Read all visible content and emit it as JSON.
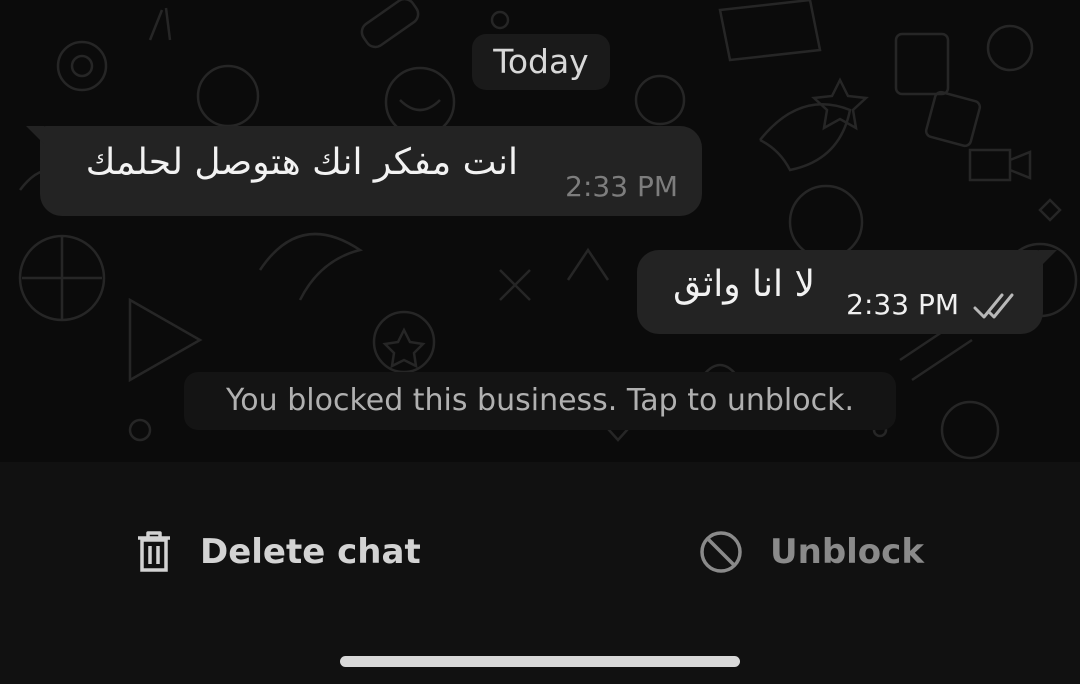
{
  "chat": {
    "date_label": "Today",
    "messages": [
      {
        "direction": "incoming",
        "text": "انت مفكر انك هتوصل لحلمك",
        "time": "2:33 PM"
      },
      {
        "direction": "outgoing",
        "text": "لا انا واثق",
        "time": "2:33 PM",
        "status": "read"
      }
    ],
    "system_notice": "You blocked this business. Tap to unblock."
  },
  "actions": {
    "delete_label": "Delete chat",
    "delete_icon": "trash-icon",
    "unblock_label": "Unblock",
    "unblock_icon": "block-icon"
  },
  "colors": {
    "background": "#0b0b0b",
    "bubble": "#232323",
    "bottom_bar": "#111111"
  }
}
